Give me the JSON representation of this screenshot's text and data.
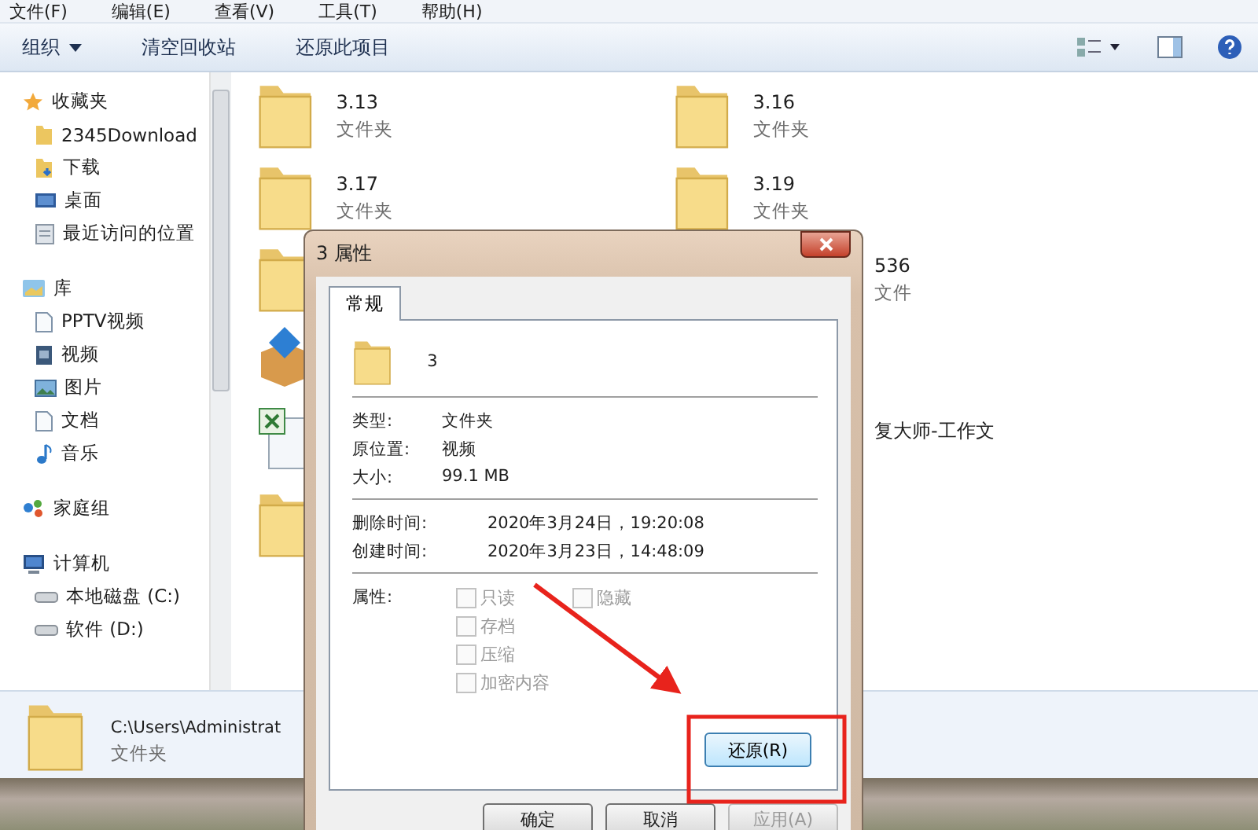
{
  "menu": [
    "文件(F)",
    "编辑(E)",
    "查看(V)",
    "工具(T)",
    "帮助(H)"
  ],
  "toolbar": [
    {
      "label": "组织",
      "dropdown": true
    },
    {
      "label": "清空回收站",
      "dropdown": false
    },
    {
      "label": "还原此项目",
      "dropdown": false
    }
  ],
  "nav": [
    {
      "label": "收藏夹",
      "kind": "star",
      "children": [
        {
          "label": "2345Download",
          "kind": "folder"
        },
        {
          "label": "下载",
          "kind": "download"
        },
        {
          "label": "桌面",
          "kind": "desktop"
        },
        {
          "label": "最近访问的位置",
          "kind": "recent"
        }
      ]
    },
    {
      "label": "库",
      "kind": "library",
      "children": [
        {
          "label": "PPTV视频",
          "kind": "document"
        },
        {
          "label": "视频",
          "kind": "video"
        },
        {
          "label": "图片",
          "kind": "picture"
        },
        {
          "label": "文档",
          "kind": "document"
        },
        {
          "label": "音乐",
          "kind": "music"
        }
      ]
    },
    {
      "label": "家庭组",
      "kind": "homegroup"
    },
    {
      "label": "计算机",
      "kind": "computer",
      "children": [
        {
          "label": "本地磁盘 (C:)",
          "kind": "drive"
        },
        {
          "label": "软件 (D:)",
          "kind": "drive"
        }
      ]
    }
  ],
  "rows": [
    {
      "left": {
        "kind": "folder",
        "name": "3.13",
        "type": "文件夹"
      },
      "right": {
        "kind": "folder",
        "name": "3.16",
        "type": "文件夹"
      }
    },
    {
      "left": {
        "kind": "folder",
        "name": "3.17",
        "type": "文件夹"
      },
      "right": {
        "kind": "folder",
        "name": "3.19",
        "type": "文件夹"
      }
    },
    {
      "left": {
        "kind": "folder"
      },
      "right": {
        "kind": "clipped",
        "name": "536",
        "type": "文件"
      }
    },
    {
      "left": {
        "kind": "package"
      }
    },
    {
      "left": {
        "kind": "sheet"
      },
      "right": {
        "kind": "clipped",
        "name": "复大师-工作文"
      }
    },
    {
      "left": {
        "kind": "folder"
      }
    }
  ],
  "details": {
    "path": "C:\\Users\\Administrat",
    "type": "文件夹"
  },
  "dialog": {
    "title": "3 属性",
    "tabs": [
      {
        "label": "常规",
        "selected": true
      }
    ],
    "name": "3",
    "info": [
      {
        "label": "类型:",
        "value": "文件夹"
      },
      {
        "label": "原位置:",
        "value": "视频"
      },
      {
        "label": "大小:",
        "value": "99.1 MB"
      }
    ],
    "times": [
      {
        "label": "删除时间:",
        "value": "2020年3月24日，19:20:08"
      },
      {
        "label": "创建时间:",
        "value": "2020年3月23日，14:48:09"
      }
    ],
    "attributes_label": "属性:",
    "attributes": {
      "left": [
        {
          "label": "只读",
          "checked": false,
          "disabled": true
        },
        {
          "label": "存档",
          "checked": false,
          "disabled": true
        },
        {
          "label": "压缩",
          "checked": false,
          "disabled": true
        },
        {
          "label": "加密内容",
          "checked": false,
          "disabled": true
        }
      ],
      "right": [
        {
          "label": "隐藏",
          "checked": false,
          "disabled": true
        }
      ]
    },
    "restore_button": "还原(R)",
    "buttons": [
      {
        "label": "确定",
        "disabled": false
      },
      {
        "label": "取消",
        "disabled": false
      },
      {
        "label": "应用(A)",
        "disabled": true
      }
    ]
  }
}
